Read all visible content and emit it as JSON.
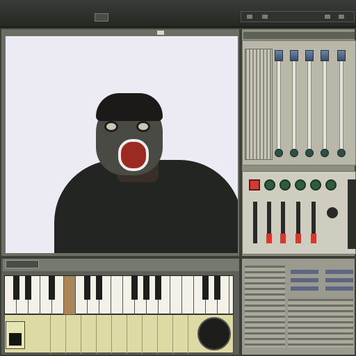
{
  "app": {
    "title": "",
    "header_badge": ""
  },
  "viewer": {
    "label": "",
    "content": "webcam-video"
  },
  "mixer": {
    "channels": 5,
    "channel_levels": [
      0.9,
      0.9,
      0.9,
      0.9,
      0.9
    ],
    "led_buttons": 5,
    "accent_red": "#d23b31",
    "led_green": "#2f5c3d"
  },
  "keyboard": {
    "white_keys": 19,
    "pads": 14
  },
  "rack": {
    "switch_count": 6
  },
  "colors": {
    "chassis": "#2b2e28",
    "panel": "#8e907f",
    "key_white": "#f3f1e8",
    "key_black": "#1e1e1c",
    "pad_yellow": "#dedaa6"
  }
}
